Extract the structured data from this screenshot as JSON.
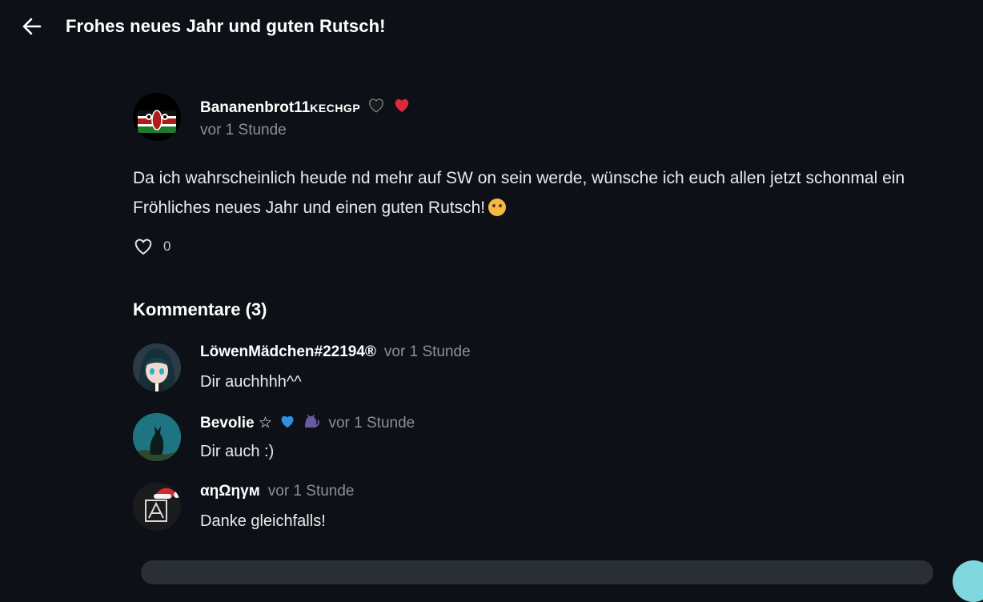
{
  "header": {
    "title": "Frohes neues Jahr und guten Rutsch!"
  },
  "post": {
    "author_name": "Bananenbrot11",
    "author_tag": "KECHGP",
    "time": "vor 1 Stunde",
    "body": "Da ich wahrscheinlich heude nd mehr auf SW on sein werde, wünsche ich euch allen jetzt schonmal ein Fröhliches neues Jahr und einen guten Rutsch!",
    "like_count": "0"
  },
  "comments_title": "Kommentare (3)",
  "comments": [
    {
      "name": "LöwenMädchen#22194®",
      "time": "vor 1 Stunde",
      "text": "Dir auchhhh^^"
    },
    {
      "name": "Bevolie ☆",
      "time": "vor 1 Stunde",
      "text": "Dir auch :)"
    },
    {
      "name": "αηΩηγм",
      "time": "vor 1 Stunde",
      "text": "Danke gleichfalls!"
    }
  ],
  "colors": {
    "background": "#0d1117",
    "accent": "#7fd6dd",
    "muted_text": "#8b8f96"
  },
  "icons": [
    "arrow-left-icon",
    "heart-outline-icon",
    "black-heart-icon",
    "red-heart-icon",
    "blue-heart-icon",
    "cat-icon",
    "party-face-icon"
  ]
}
